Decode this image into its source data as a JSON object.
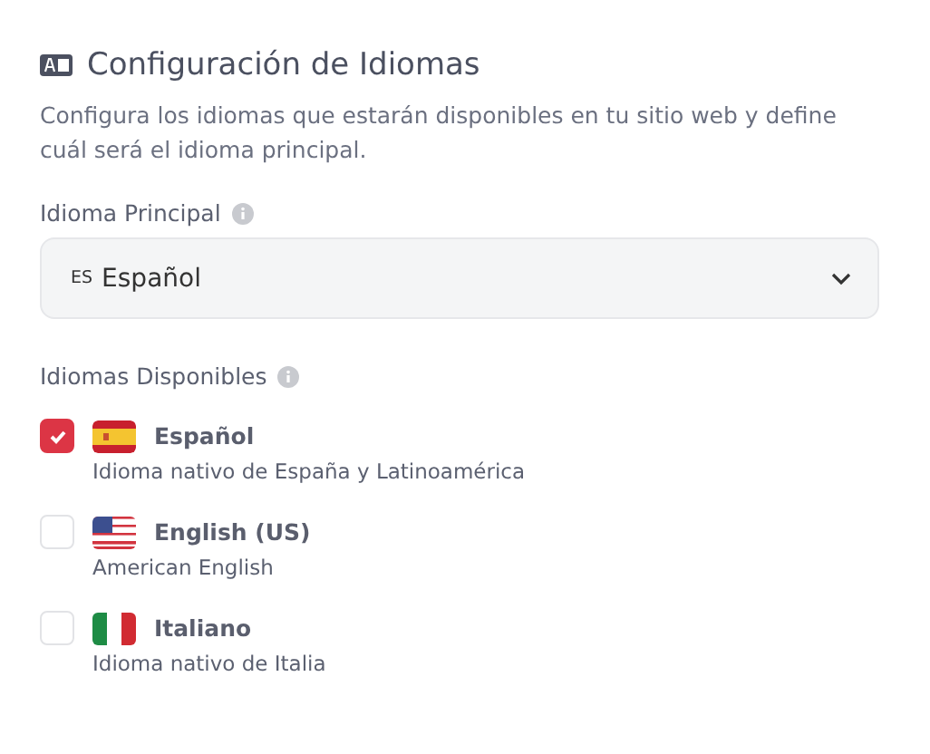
{
  "section": {
    "title": "Configuración de Idiomas",
    "description": "Configura los idiomas que estarán disponibles en tu sitio web y define cuál será el idioma principal."
  },
  "primary": {
    "label": "Idioma Principal",
    "code": "ES",
    "value": "Español"
  },
  "available": {
    "label": "Idiomas Disponibles",
    "languages": [
      {
        "name": "Español",
        "description": "Idioma nativo de España y Latinoamérica",
        "kind": "es",
        "checked": true
      },
      {
        "name": "English (US)",
        "description": "American English",
        "kind": "us",
        "checked": false
      },
      {
        "name": "Italiano",
        "description": "Idioma nativo de Italia",
        "kind": "it",
        "checked": false
      }
    ]
  }
}
